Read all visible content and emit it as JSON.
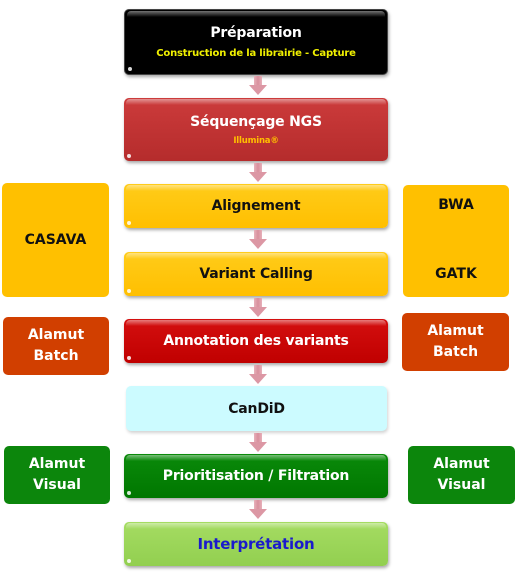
{
  "pipeline": {
    "steps": [
      {
        "title": "Préparation",
        "subtitle": "Construction de la librairie - Capture"
      },
      {
        "title": "Séquençage NGS",
        "subtitle": "Illumina®"
      },
      {
        "title": "Alignement"
      },
      {
        "title": "Variant Calling"
      },
      {
        "title": "Annotation des variants"
      },
      {
        "title": "CanDiD"
      },
      {
        "title": "Prioritisation / Filtration"
      },
      {
        "title": "Interprétation"
      }
    ]
  },
  "left_tools": {
    "casava": "CASAVA",
    "batch": [
      "Alamut",
      "Batch"
    ],
    "visual": [
      "Alamut",
      "Visual"
    ]
  },
  "right_tools": {
    "bwa": "BWA",
    "gatk": "GATK",
    "batch": [
      "Alamut",
      "Batch"
    ],
    "visual": [
      "Alamut",
      "Visual"
    ]
  },
  "colors": {
    "preparation": "#000000",
    "sequencing": "#c03030",
    "alignment": "#ffc000",
    "annotation": "#c00000",
    "candid": "#ccfbff",
    "prioritisation": "#007a00",
    "interpretation": "#92d050",
    "arrow": "#dc97a4"
  }
}
